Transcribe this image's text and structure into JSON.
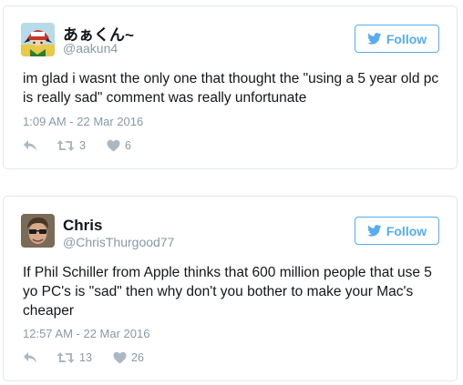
{
  "tweets": [
    {
      "name": "あぁくん~",
      "handle": "@aakun4",
      "follow_label": "Follow",
      "text": "im glad i wasnt the only one that thought the \"using a 5 year old pc is really sad\" comment was really unfortunate",
      "timestamp": "1:09 AM - 22 Mar 2016",
      "retweets": "3",
      "likes": "6",
      "avatar_icon": "anime-character-avatar"
    },
    {
      "name": "Chris",
      "handle": "@ChrisThurgood77",
      "follow_label": "Follow",
      "text": "If Phil Schiller from Apple thinks that 600 million people that use 5 yo PC's is \"sad\" then why don't you bother to make your Mac's cheaper",
      "timestamp": "12:57 AM - 22 Mar 2016",
      "retweets": "13",
      "likes": "26",
      "avatar_icon": "person-with-sunglasses-avatar"
    }
  ],
  "colors": {
    "accent": "#55acee",
    "secondary_text": "#8899a6",
    "icon": "#aab8c2",
    "border": "#e1e8ed"
  }
}
